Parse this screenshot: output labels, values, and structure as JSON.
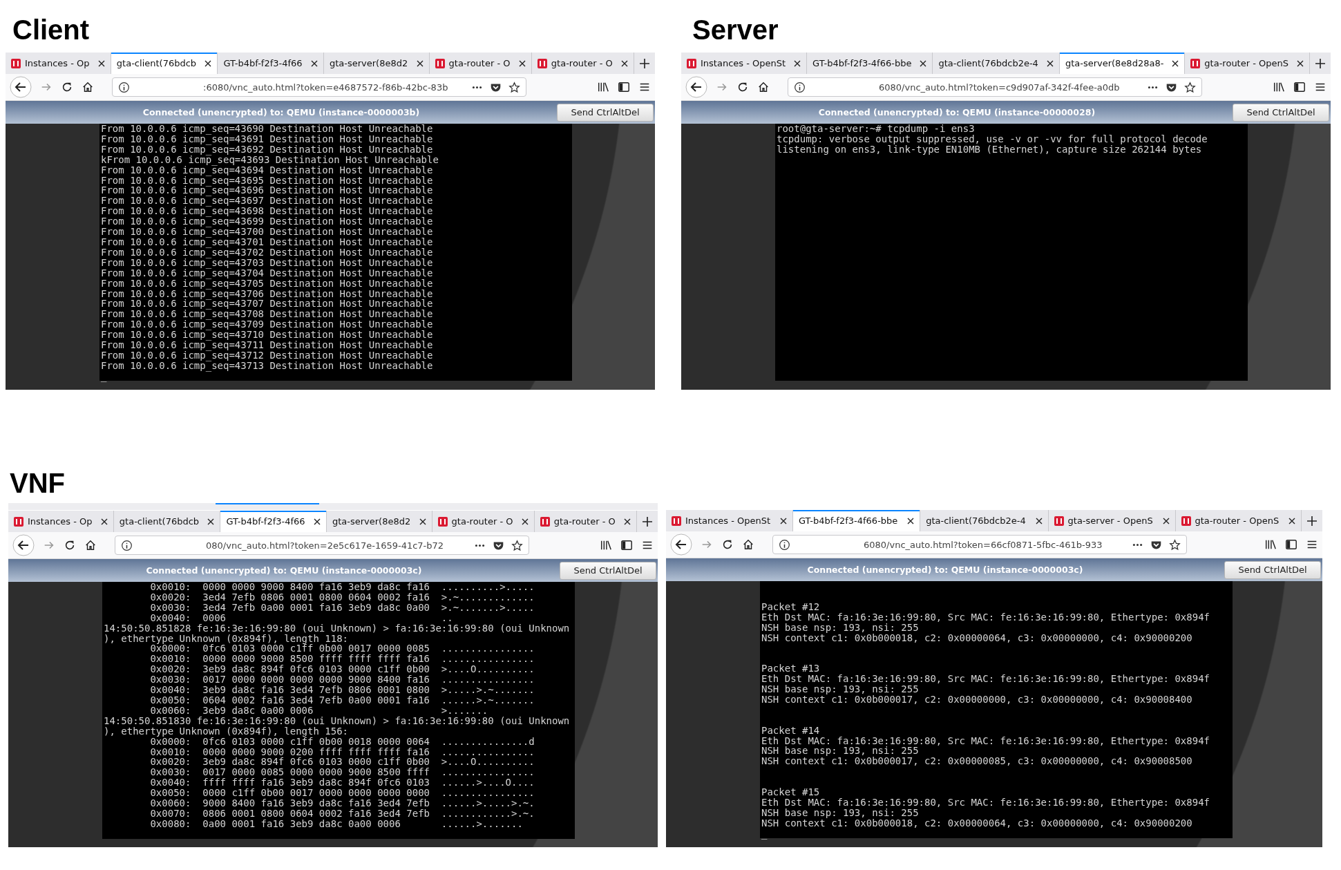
{
  "sections": [
    {
      "heading": "Client",
      "windows": [
        {
          "ghost_tab_strip": false,
          "tabs": [
            {
              "label": "Instances - Op",
              "favicon": true,
              "selected": false
            },
            {
              "label": "gta-client(76bdcb",
              "favicon": false,
              "selected": true
            },
            {
              "label": "GT-b4bf-f2f3-4f66",
              "favicon": false,
              "selected": false
            },
            {
              "label": "gta-server(8e8d2",
              "favicon": false,
              "selected": false
            },
            {
              "label": "gta-router - O",
              "favicon": true,
              "selected": false
            },
            {
              "label": "gta-router - O",
              "favicon": true,
              "selected": false
            }
          ],
          "url": ":6080/vnc_auto.html?token=e4687572-f86b-42bc-83b",
          "status": "Connected (unencrypted) to: QEMU (instance-0000003b)",
          "button": "Send CtrlAltDel",
          "terminal": {
            "kind": "log",
            "blocks": [
              {
                "lines": [
                  "From 10.0.0.6 icmp_seq=43690 Destination Host Unreachable",
                  "From 10.0.0.6 icmp_seq=43691 Destination Host Unreachable",
                  "From 10.0.0.6 icmp_seq=43692 Destination Host Unreachable",
                  "kFrom 10.0.0.6 icmp_seq=43693 Destination Host Unreachable",
                  "From 10.0.0.6 icmp_seq=43694 Destination Host Unreachable",
                  "From 10.0.0.6 icmp_seq=43695 Destination Host Unreachable",
                  "From 10.0.0.6 icmp_seq=43696 Destination Host Unreachable",
                  "From 10.0.0.6 icmp_seq=43697 Destination Host Unreachable",
                  "From 10.0.0.6 icmp_seq=43698 Destination Host Unreachable",
                  "From 10.0.0.6 icmp_seq=43699 Destination Host Unreachable",
                  "From 10.0.0.6 icmp_seq=43700 Destination Host Unreachable",
                  "From 10.0.0.6 icmp_seq=43701 Destination Host Unreachable",
                  "From 10.0.0.6 icmp_seq=43702 Destination Host Unreachable",
                  "From 10.0.0.6 icmp_seq=43703 Destination Host Unreachable",
                  "From 10.0.0.6 icmp_seq=43704 Destination Host Unreachable",
                  "From 10.0.0.6 icmp_seq=43705 Destination Host Unreachable",
                  "From 10.0.0.6 icmp_seq=43706 Destination Host Unreachable",
                  "From 10.0.0.6 icmp_seq=43707 Destination Host Unreachable",
                  "From 10.0.0.6 icmp_seq=43708 Destination Host Unreachable",
                  "From 10.0.0.6 icmp_seq=43709 Destination Host Unreachable",
                  "From 10.0.0.6 icmp_seq=43710 Destination Host Unreachable",
                  "From 10.0.0.6 icmp_seq=43711 Destination Host Unreachable",
                  "From 10.0.0.6 icmp_seq=43712 Destination Host Unreachable",
                  "From 10.0.0.6 icmp_seq=43713 Destination Host Unreachable",
                  "_"
                ]
              }
            ]
          }
        }
      ]
    },
    {
      "heading": "Server",
      "windows": [
        {
          "ghost_tab_strip": false,
          "tabs": [
            {
              "label": "Instances - OpenSt",
              "favicon": true,
              "selected": false
            },
            {
              "label": "GT-b4bf-f2f3-4f66-bbe",
              "favicon": false,
              "selected": false
            },
            {
              "label": "gta-client(76bdcb2e-4",
              "favicon": false,
              "selected": false
            },
            {
              "label": "gta-server(8e8d28a8-",
              "favicon": false,
              "selected": true
            },
            {
              "label": "gta-router - OpenS",
              "favicon": true,
              "selected": false
            }
          ],
          "url": "6080/vnc_auto.html?token=c9d907af-342f-4fee-a0db",
          "status": "Connected (unencrypted) to: QEMU (instance-00000028)",
          "button": "Send CtrlAltDel",
          "terminal": {
            "kind": "log",
            "blocks": [
              {
                "lines": [
                  "root@gta-server:~# tcpdump -i ens3",
                  "tcpdump: verbose output suppressed, use -v or -vv for full protocol decode",
                  "listening on ens3, link-type EN10MB (Ethernet), capture size 262144 bytes"
                ]
              }
            ]
          }
        }
      ]
    },
    {
      "heading": "VNF",
      "windows": [
        {
          "ghost_tab_strip": true,
          "tabs": [
            {
              "label": "Instances - Op",
              "favicon": true,
              "selected": false
            },
            {
              "label": "gta-client(76bdcb",
              "favicon": false,
              "selected": false
            },
            {
              "label": "GT-b4bf-f2f3-4f66",
              "favicon": false,
              "selected": true
            },
            {
              "label": "gta-server(8e8d2",
              "favicon": false,
              "selected": false
            },
            {
              "label": "gta-router - O",
              "favicon": true,
              "selected": false
            },
            {
              "label": "gta-router - O",
              "favicon": true,
              "selected": false
            }
          ],
          "url": "080/vnc_auto.html?token=2e5c617e-1659-41c7-b72",
          "status": "Connected (unencrypted) to: QEMU (instance-0000003c)",
          "button": "Send CtrlAltDel",
          "terminal": {
            "kind": "log",
            "blocks": [
              {
                "lines": [
                  "        0x0010:  0000 0000 9000 8400 fa16 3eb9 da8c fa16  ..........>.....",
                  "        0x0020:  3ed4 7efb 0806 0001 0800 0604 0002 fa16  >.~.............",
                  "        0x0030:  3ed4 7efb 0a00 0001 fa16 3eb9 da8c 0a00  >.~.......>.....",
                  "        0x0040:  0006                                     ..",
                  "14:50:50.851828 fe:16:3e:16:99:80 (oui Unknown) > fa:16:3e:16:99:80 (oui Unknown",
                  "), ethertype Unknown (0x894f), length 118:",
                  "        0x0000:  0fc6 0103 0000 c1ff 0b00 0017 0000 0085  ................",
                  "        0x0010:  0000 0000 9000 8500 ffff ffff ffff fa16  ................",
                  "        0x0020:  3eb9 da8c 894f 0fc6 0103 0000 c1ff 0b00  >....O..........",
                  "        0x0030:  0017 0000 0000 0000 0000 9000 8400 fa16  ................",
                  "        0x0040:  3eb9 da8c fa16 3ed4 7efb 0806 0001 0800  >.....>.~.......",
                  "        0x0050:  0604 0002 fa16 3ed4 7efb 0a00 0001 fa16  ......>.~.......",
                  "        0x0060:  3eb9 da8c 0a00 0006                      >.......",
                  "14:50:50.851830 fe:16:3e:16:99:80 (oui Unknown) > fa:16:3e:16:99:80 (oui Unknown",
                  "), ethertype Unknown (0x894f), length 156:",
                  "        0x0000:  0fc6 0103 0000 c1ff 0b00 0018 0000 0064  ...............d",
                  "        0x0010:  0000 0000 9000 0200 ffff ffff ffff fa16  ................",
                  "        0x0020:  3eb9 da8c 894f 0fc6 0103 0000 c1ff 0b00  >....O..........",
                  "        0x0030:  0017 0000 0085 0000 0000 9000 8500 ffff  ................",
                  "        0x0040:  ffff ffff fa16 3eb9 da8c 894f 0fc6 0103  ......>....O....",
                  "        0x0050:  0000 c1ff 0b00 0017 0000 0000 0000 0000  ................",
                  "        0x0060:  9000 8400 fa16 3eb9 da8c fa16 3ed4 7efb  ......>.....>.~.",
                  "        0x0070:  0806 0001 0800 0604 0002 fa16 3ed4 7efb  ............>.~.",
                  "        0x0080:  0a00 0001 fa16 3eb9 da8c 0a00 0006       ......>......."
                ]
              }
            ]
          }
        },
        {
          "ghost_tab_strip": false,
          "tabs": [
            {
              "label": "Instances - OpenSt",
              "favicon": true,
              "selected": false
            },
            {
              "label": "GT-b4bf-f2f3-4f66-bbe",
              "favicon": false,
              "selected": true
            },
            {
              "label": "gta-client(76bdcb2e-4",
              "favicon": false,
              "selected": false
            },
            {
              "label": "gta-server - OpenS",
              "favicon": true,
              "selected": false
            },
            {
              "label": "gta-router - OpenS",
              "favicon": true,
              "selected": false
            }
          ],
          "url": "6080/vnc_auto.html?token=66cf0871-5fbc-461b-933",
          "status": "Connected (unencrypted) to: QEMU (instance-0000003c)",
          "button": "Send CtrlAltDel",
          "terminal": {
            "kind": "packets",
            "blocks": [
              {
                "lines": [
                  "Packet #12",
                  "Eth Dst MAC: fa:16:3e:16:99:80, Src MAC: fe:16:3e:16:99:80, Ethertype: 0x894f",
                  "NSH base nsp: 193, nsi: 255",
                  "NSH context c1: 0x0b000018, c2: 0x00000064, c3: 0x00000000, c4: 0x90000200"
                ]
              },
              {
                "lines": [
                  "Packet #13",
                  "Eth Dst MAC: fa:16:3e:16:99:80, Src MAC: fe:16:3e:16:99:80, Ethertype: 0x894f",
                  "NSH base nsp: 193, nsi: 255",
                  "NSH context c1: 0x0b000017, c2: 0x00000000, c3: 0x00000000, c4: 0x90008400"
                ]
              },
              {
                "lines": [
                  "Packet #14",
                  "Eth Dst MAC: fa:16:3e:16:99:80, Src MAC: fe:16:3e:16:99:80, Ethertype: 0x894f",
                  "NSH base nsp: 193, nsi: 255",
                  "NSH context c1: 0x0b000017, c2: 0x00000085, c3: 0x00000000, c4: 0x90008500"
                ]
              },
              {
                "lines": [
                  "Packet #15",
                  "Eth Dst MAC: fa:16:3e:16:99:80, Src MAC: fe:16:3e:16:99:80, Ethertype: 0x894f",
                  "NSH base nsp: 193, nsi: 255",
                  "NSH context c1: 0x0b000018, c2: 0x00000064, c3: 0x00000000, c4: 0x90000200",
                  "_"
                ]
              }
            ]
          }
        }
      ]
    }
  ]
}
